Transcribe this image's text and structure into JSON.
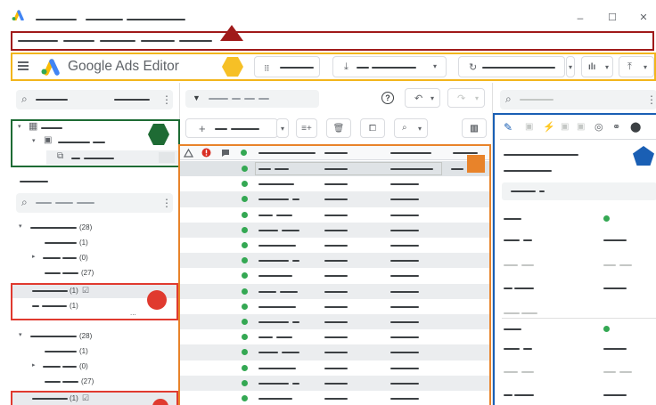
{
  "titlebar": {
    "minimize": "–",
    "maximize": "☐",
    "close": "✕"
  },
  "appbar": {
    "menu_icon": "hamburger-menu-icon",
    "logo_icon": "google-ads-logo-icon",
    "title": "Google Ads Editor",
    "dropdown_glyph": "▾"
  },
  "search": {
    "more_glyph": "⋮",
    "search_glyph": "⌕"
  },
  "tree_counts": {
    "a1": "(28)",
    "a2": "(1)",
    "a3": "(0)",
    "a4": "(27)",
    "a5": "(1)",
    "a6": "(1)",
    "b1": "(28)",
    "b2": "(1)",
    "b3": "(0)",
    "b4": "(27)",
    "b5": "(1)"
  },
  "tree_more": "...",
  "grid": {
    "filter_glyph": "▼",
    "help_glyph": "?",
    "add_glyph": "+",
    "header_icons": [
      "warning-outline-icon",
      "error-icon",
      "comment-icon",
      "status-icon"
    ],
    "row_count": 16
  },
  "editor": {
    "tab_icons": [
      "pencil-icon",
      "image-icon",
      "wand-icon",
      "image-icon",
      "image-icon",
      "target-icon",
      "link-icon",
      "label-icon"
    ]
  },
  "markers": {
    "triangle_color": "#a01a1a",
    "hexagon_color": "#1e6b34",
    "circle_color": "#e03a2f",
    "square_color": "#e8832a",
    "pentagon_color": "#1a5fb4",
    "yellow_hex_color": "#f6c026"
  },
  "frame_colors": {
    "menu": "#a01a1a",
    "toolbar": "#f2b51c",
    "tree": "#1e6b34",
    "selection": "#e03a2f",
    "grid": "#e8832a",
    "editor": "#1a5fb4"
  }
}
